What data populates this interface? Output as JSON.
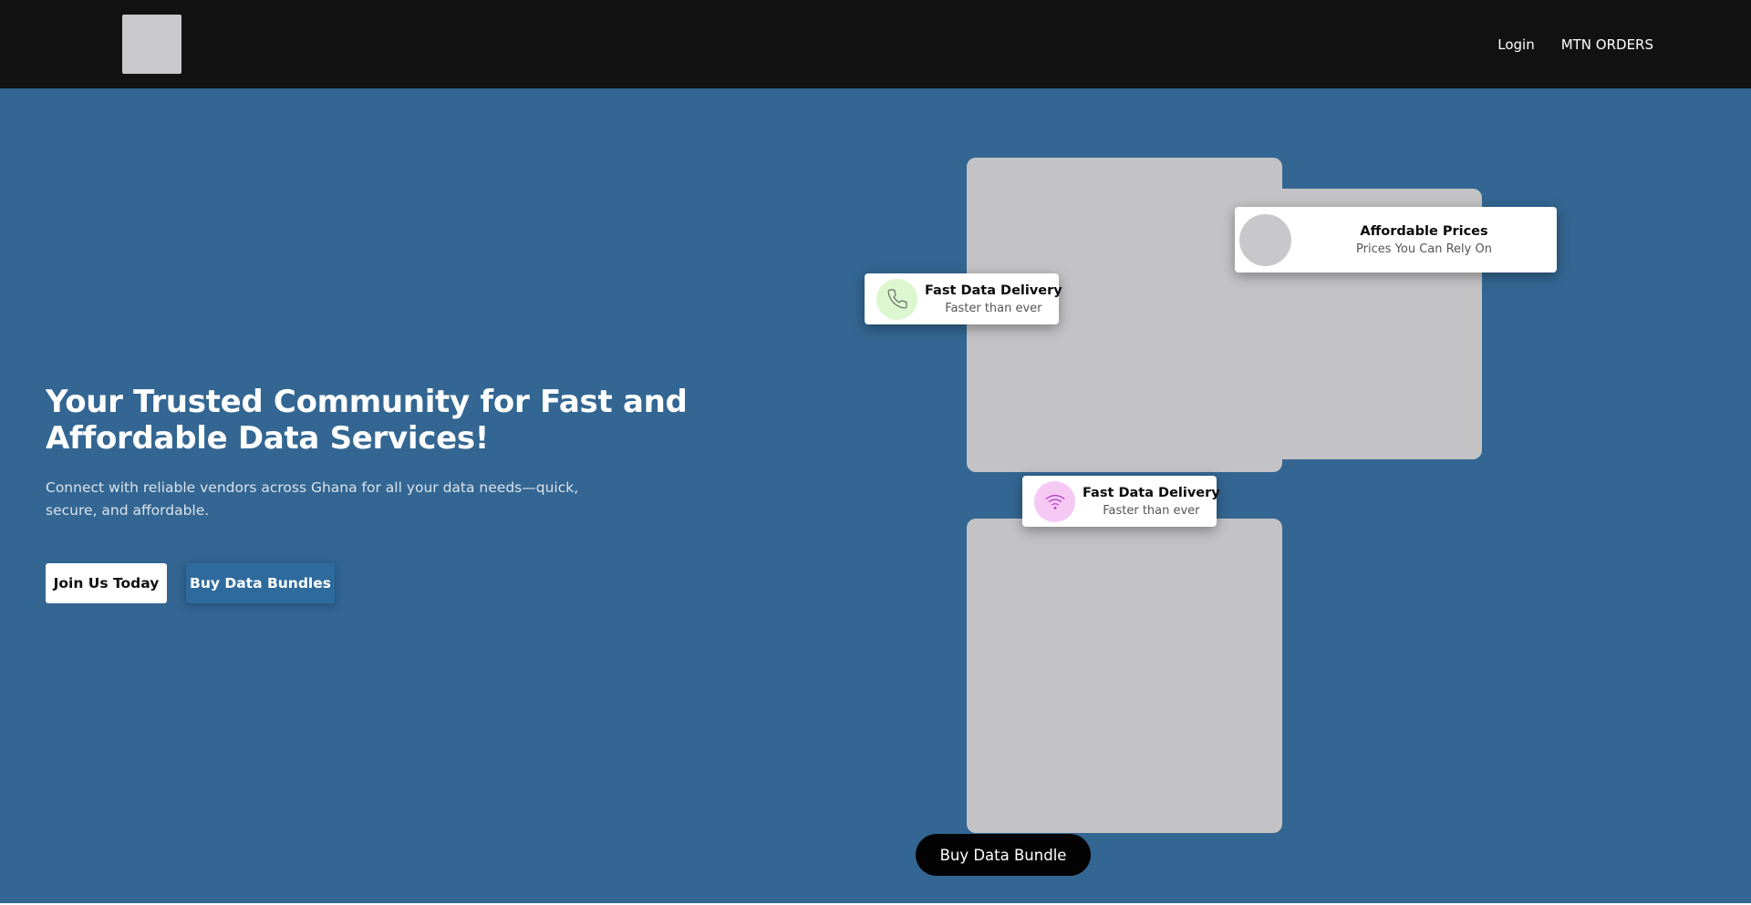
{
  "header": {
    "logo_alt": "logo",
    "nav": {
      "login": "Login",
      "mtn_orders": "MTN ORDERS"
    }
  },
  "hero": {
    "title": "Your Trusted Community for Fast and Affordable Data Services!",
    "subtitle": "Connect with reliable vendors across Ghana for all your data needs—quick, secure, and affordable.",
    "join_button": "Join Us Today",
    "buy_bundles_button": "Buy Data Bundles"
  },
  "feature_cards": [
    {
      "title": "Affordable Prices",
      "subtitle": "Prices You Can Rely On",
      "icon": "avatar-placeholder"
    },
    {
      "title": "Fast Data Delivery",
      "subtitle": "Faster than ever",
      "icon": "phone-icon",
      "icon_color": "#dcf7cf"
    },
    {
      "title": "Fast Data Delivery",
      "subtitle": "Faster than ever",
      "icon": "wifi-icon",
      "icon_color": "#f6c8f4"
    }
  ],
  "cta": {
    "buy_bundle_button": "Buy Data Bundle"
  },
  "colors": {
    "navbar_bg": "#121212",
    "hero_bg": "#336692",
    "placeholder": "#c3c3c5"
  }
}
